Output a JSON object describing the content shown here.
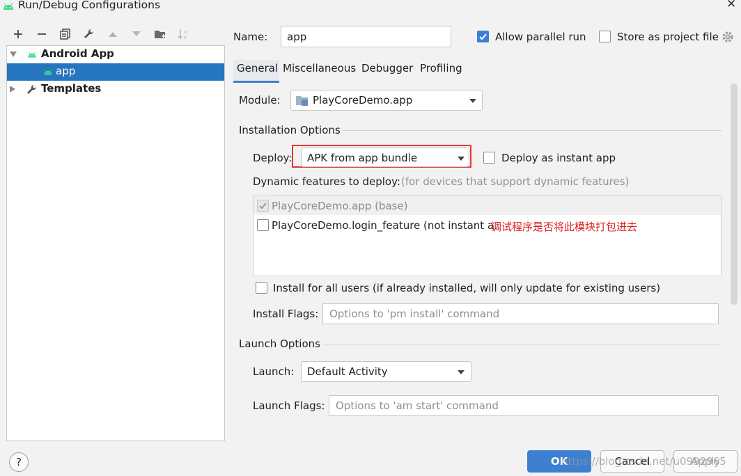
{
  "window": {
    "title": "Run/Debug Configurations"
  },
  "toolbar": {
    "icons": [
      "add-icon",
      "remove-icon",
      "copy-icon",
      "wrench-icon",
      "move-up-icon",
      "move-down-icon",
      "folder-add-icon",
      "sort-icon"
    ]
  },
  "tree": {
    "android_app": "Android App",
    "app": "app",
    "templates": "Templates"
  },
  "name": {
    "label": "Name:",
    "value": "app"
  },
  "allow_parallel": {
    "label": "Allow parallel run",
    "checked": true
  },
  "store_project": {
    "label": "Store as project file",
    "checked": false
  },
  "tabs": [
    "General",
    "Miscellaneous",
    "Debugger",
    "Profiling"
  ],
  "module": {
    "label": "Module:",
    "value": "PlayCoreDemo.app"
  },
  "installation": {
    "title": "Installation Options",
    "deploy_label": "Deploy:",
    "deploy_value": "APK from app bundle",
    "instant_label": "Deploy as instant app",
    "dynamic_label": "Dynamic features to deploy:",
    "dynamic_hint": "(for devices that support dynamic features)",
    "features": [
      {
        "label": "PlayCoreDemo.app (base)",
        "checked": true,
        "disabled": true
      },
      {
        "label": "PlayCoreDemo.login_feature (not instant a..",
        "checked": false
      }
    ],
    "annotation": "调试程序是否将此模块打包进去",
    "all_users_label": "Install for all users (if already installed, will only update for existing users)",
    "flags_label": "Install Flags:",
    "flags_placeholder": "Options to 'pm install' command"
  },
  "launch": {
    "title": "Launch Options",
    "launch_label": "Launch:",
    "launch_value": "Default Activity",
    "flags_label": "Launch Flags:",
    "flags_placeholder": "Options to 'am start' command"
  },
  "buttons": {
    "help": "?",
    "ok": "OK",
    "cancel": "Cancel",
    "apply": "Apply"
  },
  "watermark": "https://blog.csdn.net/u0992965",
  "colors": {
    "selection": "#2675bf",
    "android_green": "#3ddc84",
    "annotation_red": "#e02020",
    "highlight_border": "#e53935",
    "ok_blue": "#3d7fd1"
  }
}
